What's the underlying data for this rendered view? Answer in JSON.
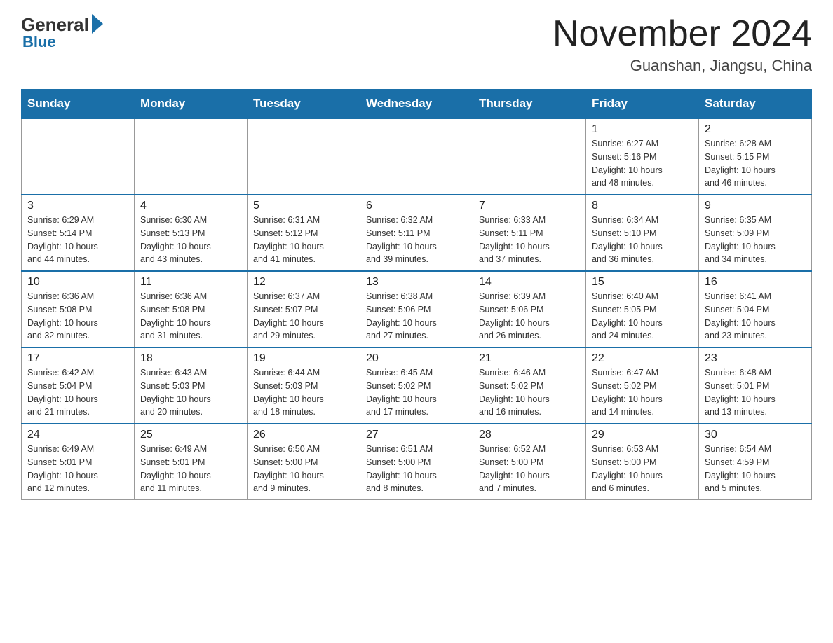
{
  "header": {
    "logo": {
      "general": "General",
      "blue": "Blue"
    },
    "month": "November 2024",
    "location": "Guanshan, Jiangsu, China"
  },
  "days_of_week": [
    "Sunday",
    "Monday",
    "Tuesday",
    "Wednesday",
    "Thursday",
    "Friday",
    "Saturday"
  ],
  "weeks": [
    {
      "days": [
        {
          "date": "",
          "info": ""
        },
        {
          "date": "",
          "info": ""
        },
        {
          "date": "",
          "info": ""
        },
        {
          "date": "",
          "info": ""
        },
        {
          "date": "",
          "info": ""
        },
        {
          "date": "1",
          "info": "Sunrise: 6:27 AM\nSunset: 5:16 PM\nDaylight: 10 hours\nand 48 minutes."
        },
        {
          "date": "2",
          "info": "Sunrise: 6:28 AM\nSunset: 5:15 PM\nDaylight: 10 hours\nand 46 minutes."
        }
      ]
    },
    {
      "days": [
        {
          "date": "3",
          "info": "Sunrise: 6:29 AM\nSunset: 5:14 PM\nDaylight: 10 hours\nand 44 minutes."
        },
        {
          "date": "4",
          "info": "Sunrise: 6:30 AM\nSunset: 5:13 PM\nDaylight: 10 hours\nand 43 minutes."
        },
        {
          "date": "5",
          "info": "Sunrise: 6:31 AM\nSunset: 5:12 PM\nDaylight: 10 hours\nand 41 minutes."
        },
        {
          "date": "6",
          "info": "Sunrise: 6:32 AM\nSunset: 5:11 PM\nDaylight: 10 hours\nand 39 minutes."
        },
        {
          "date": "7",
          "info": "Sunrise: 6:33 AM\nSunset: 5:11 PM\nDaylight: 10 hours\nand 37 minutes."
        },
        {
          "date": "8",
          "info": "Sunrise: 6:34 AM\nSunset: 5:10 PM\nDaylight: 10 hours\nand 36 minutes."
        },
        {
          "date": "9",
          "info": "Sunrise: 6:35 AM\nSunset: 5:09 PM\nDaylight: 10 hours\nand 34 minutes."
        }
      ]
    },
    {
      "days": [
        {
          "date": "10",
          "info": "Sunrise: 6:36 AM\nSunset: 5:08 PM\nDaylight: 10 hours\nand 32 minutes."
        },
        {
          "date": "11",
          "info": "Sunrise: 6:36 AM\nSunset: 5:08 PM\nDaylight: 10 hours\nand 31 minutes."
        },
        {
          "date": "12",
          "info": "Sunrise: 6:37 AM\nSunset: 5:07 PM\nDaylight: 10 hours\nand 29 minutes."
        },
        {
          "date": "13",
          "info": "Sunrise: 6:38 AM\nSunset: 5:06 PM\nDaylight: 10 hours\nand 27 minutes."
        },
        {
          "date": "14",
          "info": "Sunrise: 6:39 AM\nSunset: 5:06 PM\nDaylight: 10 hours\nand 26 minutes."
        },
        {
          "date": "15",
          "info": "Sunrise: 6:40 AM\nSunset: 5:05 PM\nDaylight: 10 hours\nand 24 minutes."
        },
        {
          "date": "16",
          "info": "Sunrise: 6:41 AM\nSunset: 5:04 PM\nDaylight: 10 hours\nand 23 minutes."
        }
      ]
    },
    {
      "days": [
        {
          "date": "17",
          "info": "Sunrise: 6:42 AM\nSunset: 5:04 PM\nDaylight: 10 hours\nand 21 minutes."
        },
        {
          "date": "18",
          "info": "Sunrise: 6:43 AM\nSunset: 5:03 PM\nDaylight: 10 hours\nand 20 minutes."
        },
        {
          "date": "19",
          "info": "Sunrise: 6:44 AM\nSunset: 5:03 PM\nDaylight: 10 hours\nand 18 minutes."
        },
        {
          "date": "20",
          "info": "Sunrise: 6:45 AM\nSunset: 5:02 PM\nDaylight: 10 hours\nand 17 minutes."
        },
        {
          "date": "21",
          "info": "Sunrise: 6:46 AM\nSunset: 5:02 PM\nDaylight: 10 hours\nand 16 minutes."
        },
        {
          "date": "22",
          "info": "Sunrise: 6:47 AM\nSunset: 5:02 PM\nDaylight: 10 hours\nand 14 minutes."
        },
        {
          "date": "23",
          "info": "Sunrise: 6:48 AM\nSunset: 5:01 PM\nDaylight: 10 hours\nand 13 minutes."
        }
      ]
    },
    {
      "days": [
        {
          "date": "24",
          "info": "Sunrise: 6:49 AM\nSunset: 5:01 PM\nDaylight: 10 hours\nand 12 minutes."
        },
        {
          "date": "25",
          "info": "Sunrise: 6:49 AM\nSunset: 5:01 PM\nDaylight: 10 hours\nand 11 minutes."
        },
        {
          "date": "26",
          "info": "Sunrise: 6:50 AM\nSunset: 5:00 PM\nDaylight: 10 hours\nand 9 minutes."
        },
        {
          "date": "27",
          "info": "Sunrise: 6:51 AM\nSunset: 5:00 PM\nDaylight: 10 hours\nand 8 minutes."
        },
        {
          "date": "28",
          "info": "Sunrise: 6:52 AM\nSunset: 5:00 PM\nDaylight: 10 hours\nand 7 minutes."
        },
        {
          "date": "29",
          "info": "Sunrise: 6:53 AM\nSunset: 5:00 PM\nDaylight: 10 hours\nand 6 minutes."
        },
        {
          "date": "30",
          "info": "Sunrise: 6:54 AM\nSunset: 4:59 PM\nDaylight: 10 hours\nand 5 minutes."
        }
      ]
    }
  ]
}
